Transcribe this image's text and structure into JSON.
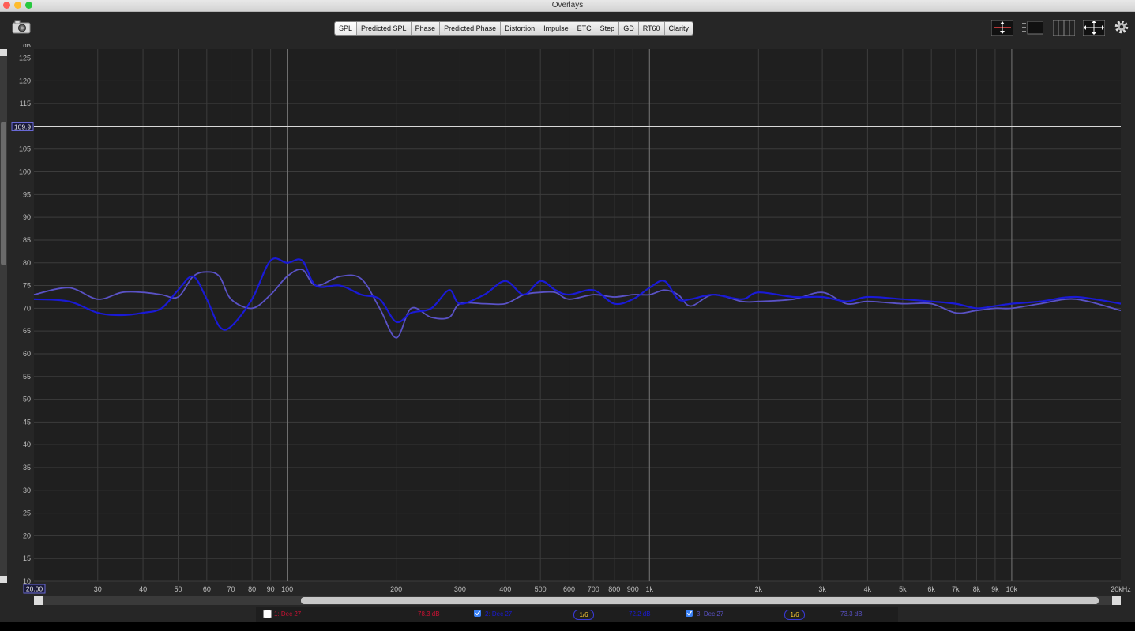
{
  "window": {
    "title": "Overlays"
  },
  "tabs": [
    {
      "label": "SPL",
      "active": true
    },
    {
      "label": "Predicted SPL"
    },
    {
      "label": "Phase"
    },
    {
      "label": "Predicted Phase"
    },
    {
      "label": "Distortion"
    },
    {
      "label": "Impulse"
    },
    {
      "label": "ETC"
    },
    {
      "label": "Step"
    },
    {
      "label": "GD"
    },
    {
      "label": "RT60"
    },
    {
      "label": "Clarity"
    }
  ],
  "plot": {
    "y_unit": "dB",
    "cursor_value": "109.9",
    "x_start_label": "20.00",
    "y_ticks": [
      "125",
      "120",
      "115",
      "110",
      "105",
      "100",
      "95",
      "90",
      "85",
      "80",
      "75",
      "70",
      "65",
      "60",
      "55",
      "50",
      "45",
      "40",
      "35",
      "30",
      "25",
      "20",
      "15",
      "10"
    ],
    "x_ticks": [
      "30",
      "40",
      "50",
      "60",
      "70",
      "80",
      "90",
      "100",
      "200",
      "300",
      "400",
      "500",
      "600",
      "700",
      "800",
      "900",
      "1k",
      "2k",
      "3k",
      "4k",
      "5k",
      "6k",
      "7k",
      "8k",
      "9k",
      "10k",
      "20kHz"
    ]
  },
  "chart_data": {
    "type": "line",
    "xlim": [
      20,
      20000
    ],
    "ylim": [
      10,
      127
    ],
    "x_scale": "log",
    "grid": true,
    "series": [
      {
        "color": "#1a1ad6",
        "x": [
          20,
          25,
          30,
          35,
          40,
          45,
          50,
          55,
          60,
          65,
          70,
          80,
          90,
          100,
          110,
          120,
          140,
          160,
          180,
          200,
          220,
          250,
          280,
          300,
          350,
          400,
          450,
          500,
          550,
          600,
          700,
          800,
          900,
          1000,
          1100,
          1200,
          1300,
          1500,
          1800,
          2000,
          2500,
          3000,
          3500,
          4000,
          5000,
          6000,
          7000,
          8000,
          9000,
          10000,
          12000,
          15000,
          20000
        ],
        "y": [
          72,
          71.5,
          69,
          68.5,
          69,
          70,
          74,
          77,
          72,
          66,
          66,
          72,
          80.5,
          80,
          80.5,
          75,
          75,
          73,
          72,
          67,
          69,
          70,
          74,
          71,
          73,
          76,
          73,
          76,
          74,
          73,
          74,
          71,
          72,
          74.5,
          76,
          72,
          72,
          73,
          72,
          73.5,
          72.5,
          72.5,
          71.5,
          72.5,
          72,
          71.5,
          71,
          70,
          70.5,
          71,
          71.5,
          72.5,
          71
        ]
      },
      {
        "color": "#5a52c6",
        "x": [
          20,
          25,
          30,
          35,
          40,
          45,
          50,
          55,
          60,
          65,
          70,
          80,
          90,
          100,
          110,
          120,
          140,
          160,
          180,
          200,
          220,
          250,
          280,
          300,
          350,
          400,
          450,
          500,
          550,
          600,
          700,
          800,
          900,
          1000,
          1100,
          1200,
          1300,
          1500,
          1800,
          2000,
          2500,
          3000,
          3500,
          4000,
          5000,
          6000,
          7000,
          8000,
          9000,
          10000,
          12000,
          15000,
          20000
        ],
        "y": [
          73,
          74.5,
          72,
          73.5,
          73.5,
          73,
          72.5,
          77,
          78,
          77,
          72,
          70,
          73,
          77,
          78.5,
          75,
          77,
          76.5,
          70,
          63.5,
          70,
          68,
          68,
          71,
          71,
          71,
          73,
          73.5,
          73.5,
          72,
          73,
          72.5,
          73,
          73,
          74,
          73,
          70.5,
          73,
          71.5,
          71.5,
          72,
          73.5,
          71,
          71.5,
          71,
          71,
          69,
          69.5,
          70,
          70,
          71,
          72,
          69.5
        ]
      }
    ]
  },
  "legend": {
    "items": [
      {
        "label": "1: Dec 27",
        "value": "78.3 dB",
        "checked": false,
        "color": "#cc1133"
      },
      {
        "label": "2: Dec 27",
        "value": "72.2 dB",
        "checked": true,
        "color": "#1a1ad6",
        "smoothing": "1/6"
      },
      {
        "label": "3: Dec 27",
        "value": "73.3 dB",
        "checked": true,
        "color": "#5a52c6",
        "smoothing": "1/6"
      }
    ]
  }
}
